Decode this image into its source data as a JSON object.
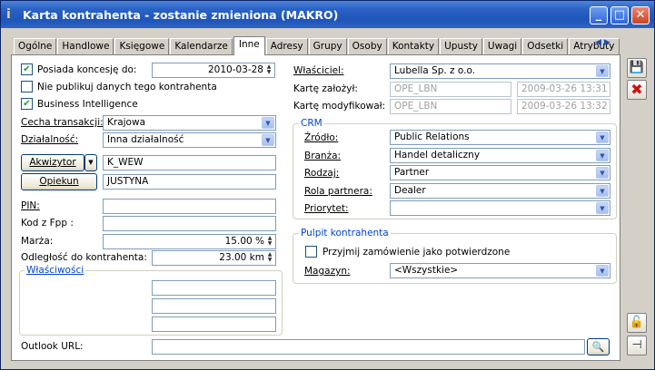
{
  "window": {
    "title": "Karta kontrahenta - zostanie zmieniona (MAKRO)"
  },
  "tabs": [
    "Ogólne",
    "Handlowe",
    "Księgowe",
    "Kalendarze",
    "Inne",
    "Adresy",
    "Grupy",
    "Osoby",
    "Kontakty",
    "Upusty",
    "Uwagi",
    "Odsetki",
    "Atrybuty"
  ],
  "active_tab": "Inne",
  "left": {
    "posiada_koncesje_label": "Posiada koncesję do:",
    "posiada_koncesje_checked": true,
    "posiada_koncesje_date": "2010-03-28",
    "nie_publikuj_label": "Nie publikuj danych tego kontrahenta",
    "nie_publikuj_checked": false,
    "bi_label": "Business Intelligence",
    "bi_checked": true,
    "cecha_label": "Cecha transakcji:",
    "cecha_value": "Krajowa",
    "dzialalnosc_label": "Działalność:",
    "dzialalnosc_value": "Inna działalność",
    "akwizytor_label": "Akwizytor",
    "akwizytor_value": "K_WEW",
    "opiekun_label": "Opiekun",
    "opiekun_value": "JUSTYNA",
    "pin_label": "PIN:",
    "pin_value": "",
    "kodfpp_label": "Kod z Fpp :",
    "kodfpp_value": "",
    "marza_label": "Marża:",
    "marza_value": "15.00 %",
    "odleglosc_label": "Odległość do kontrahenta:",
    "odleglosc_value": "23.00 km",
    "wlasciwosci_title": "Właściwości",
    "wlasciwosci_values": [
      "",
      "",
      ""
    ]
  },
  "right": {
    "wlasciciel_label": "Właściciel:",
    "wlasciciel_value": "Lubella Sp. z o.o.",
    "karte_zalozyl_label": "Kartę założył:",
    "karte_zalozyl_value": "OPE_LBN",
    "karte_zalozyl_date": "2009-03-26 13:31",
    "karte_modyfikowal_label": "Kartę modyfikował:",
    "karte_modyfikowal_value": "OPE_LBN",
    "karte_modyfikowal_date": "2009-03-26 13:32",
    "crm": {
      "title": "CRM",
      "zrodlo_label": "Źródło:",
      "zrodlo_value": "Public Relations",
      "branza_label": "Branża:",
      "branza_value": "Handel detaliczny",
      "rodzaj_label": "Rodzaj:",
      "rodzaj_value": "Partner",
      "rola_label": "Rola partnera:",
      "rola_value": "Dealer",
      "priorytet_label": "Priorytet:",
      "priorytet_value": ""
    },
    "pulpit": {
      "title": "Pulpit kontrahenta",
      "przyjmij_label": "Przyjmij zamówienie jako potwierdzone",
      "przyjmij_checked": false,
      "magazyn_label": "Magazyn:",
      "magazyn_value": "<Wszystkie>"
    }
  },
  "outlook": {
    "label": "Outlook URL:",
    "value": ""
  }
}
